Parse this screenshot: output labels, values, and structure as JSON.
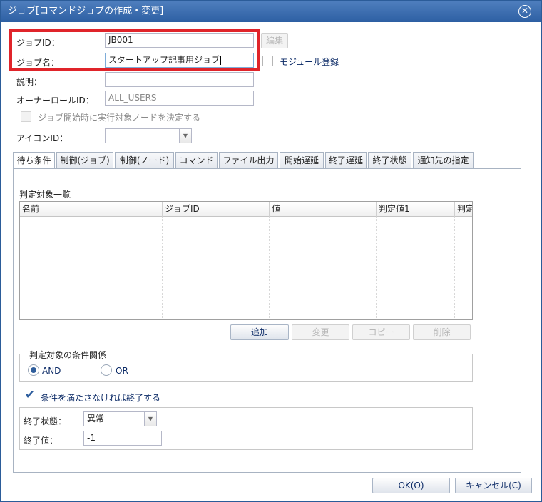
{
  "window": {
    "title": "ジョブ[コマンドジョブの作成・変更]",
    "close_icon": "close-circle-icon"
  },
  "form": {
    "job_id_label": "ジョブID：",
    "job_id_value": "JB001",
    "edit_button": "編集",
    "job_name_label": "ジョブ名：",
    "job_name_value": "スタートアップ記事用ジョブ",
    "module_register_label": "モジュール登録",
    "description_label": "説明：",
    "description_value": "",
    "owner_role_label": "オーナーロールID：",
    "owner_role_value": "ALL_USERS",
    "decide_node_label": "ジョブ開始時に実行対象ノードを決定する",
    "icon_id_label": "アイコンID：",
    "icon_id_value": ""
  },
  "tabs": [
    {
      "label": "待ち条件"
    },
    {
      "label": "制御(ジョブ)"
    },
    {
      "label": "制御(ノード)"
    },
    {
      "label": "コマンド"
    },
    {
      "label": "ファイル出力"
    },
    {
      "label": "開始遅延"
    },
    {
      "label": "終了遅延"
    },
    {
      "label": "終了状態"
    },
    {
      "label": "通知先の指定"
    }
  ],
  "wait_conditions": {
    "list_title": "判定対象一覧",
    "columns": [
      "名前",
      "ジョブID",
      "値",
      "判定値1",
      "判定"
    ],
    "rows": [],
    "buttons": {
      "add": "追加",
      "modify": "変更",
      "copy": "コピー",
      "delete": "削除"
    },
    "relation_legend": "判定対象の条件関係",
    "relation_options": [
      "AND",
      "OR"
    ],
    "relation_selected": "AND",
    "end_if_unmet_label": "条件を満たさなければ終了する",
    "end_if_unmet_checked": true,
    "end_status_label": "終了状態：",
    "end_status_value": "異常",
    "end_value_label": "終了値：",
    "end_value": "-1"
  },
  "footer": {
    "ok": "OK(O)",
    "cancel": "キャンセル(C)"
  }
}
